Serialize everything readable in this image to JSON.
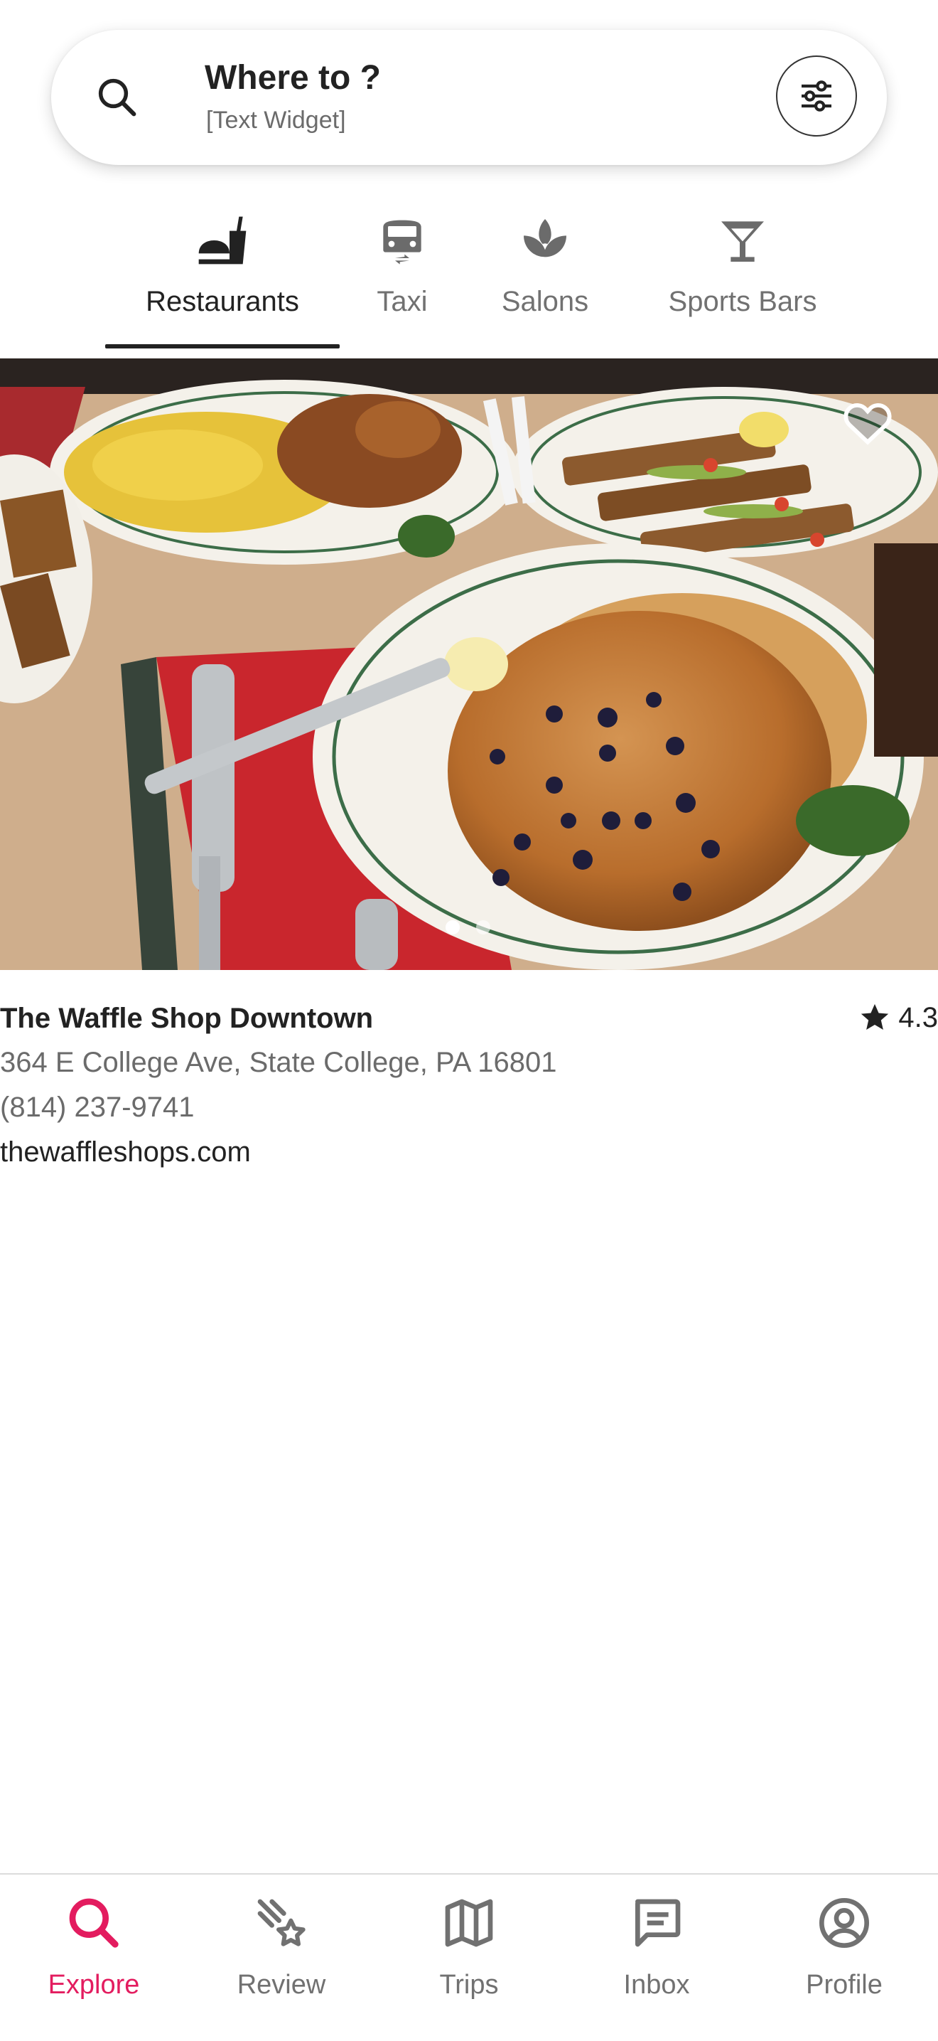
{
  "search": {
    "title": "Where to ?",
    "subtitle": "[Text Widget]",
    "icon": "search-icon",
    "filter_icon": "sliders-icon"
  },
  "categories": [
    {
      "label": "Restaurants",
      "icon": "restaurant-icon",
      "active": true
    },
    {
      "label": "Taxi",
      "icon": "taxi-icon",
      "active": false
    },
    {
      "label": "Salons",
      "icon": "spa-icon",
      "active": false
    },
    {
      "label": "Sports Bars",
      "icon": "cocktail-icon",
      "active": false
    }
  ],
  "listing": {
    "name": "The Waffle Shop Downtown",
    "rating": "4.3",
    "address": "364 E College Ave, State College, PA 16801",
    "phone": "(814) 237-9741",
    "website": "thewaffleshops.com",
    "photo_page": 1,
    "photo_count": 2
  },
  "nav": [
    {
      "label": "Explore",
      "icon": "search-icon",
      "active": true
    },
    {
      "label": "Review",
      "icon": "review-stars-icon",
      "active": false
    },
    {
      "label": "Trips",
      "icon": "map-icon",
      "active": false
    },
    {
      "label": "Inbox",
      "icon": "chat-icon",
      "active": false
    },
    {
      "label": "Profile",
      "icon": "profile-icon",
      "active": false
    }
  ],
  "colors": {
    "accent": "#e31c5f",
    "text": "#222222",
    "muted": "#717171",
    "divider": "#dcdcdc"
  }
}
